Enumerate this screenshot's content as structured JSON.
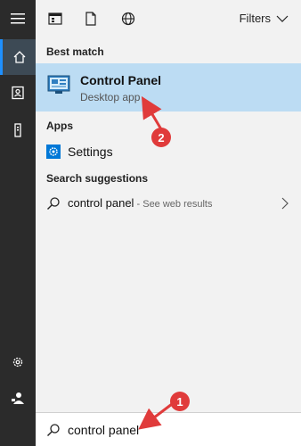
{
  "topbar": {
    "filters_label": "Filters"
  },
  "sections": {
    "best_match": "Best match",
    "apps": "Apps",
    "search_suggestions": "Search suggestions"
  },
  "best_match": {
    "title": "Control Panel",
    "subtitle": "Desktop app"
  },
  "apps": [
    {
      "label": "Settings"
    }
  ],
  "suggestions": [
    {
      "query": "control panel",
      "suffix": " - See web results"
    }
  ],
  "search": {
    "value": "control panel"
  },
  "annotations": [
    {
      "label": "1"
    },
    {
      "label": "2"
    }
  ],
  "colors": {
    "rail": "#2b2b2b",
    "highlight": "#bcdcf3",
    "accent": "#0078d7",
    "annotation": "#e03b3b"
  },
  "icons": {
    "rail": [
      "hamburger-icon",
      "home-icon",
      "contact-card-icon",
      "tower-icon",
      "settings-gear-icon",
      "user-icon"
    ],
    "topbar": [
      "apps-icon",
      "documents-icon",
      "web-icon"
    ]
  }
}
